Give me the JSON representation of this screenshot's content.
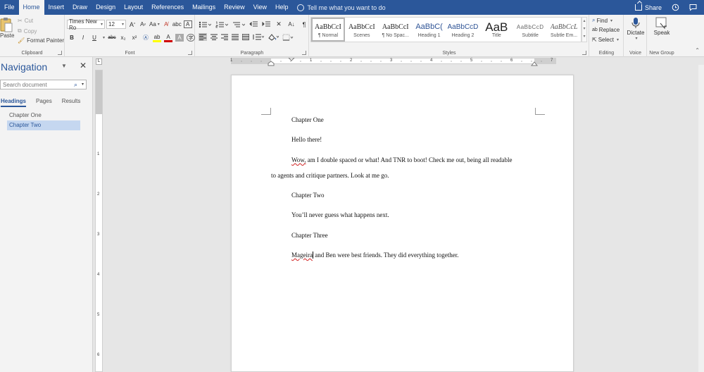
{
  "tabs": [
    {
      "label": "File"
    },
    {
      "label": "Home",
      "active": true
    },
    {
      "label": "Insert"
    },
    {
      "label": "Draw"
    },
    {
      "label": "Design"
    },
    {
      "label": "Layout"
    },
    {
      "label": "References"
    },
    {
      "label": "Mailings"
    },
    {
      "label": "Review"
    },
    {
      "label": "View"
    },
    {
      "label": "Help"
    }
  ],
  "tellme_placeholder": "Tell me what you want to do",
  "share_label": "Share",
  "ribbon": {
    "clipboard": {
      "label": "Clipboard",
      "paste": "Paste",
      "cut": "Cut",
      "copy": "Copy",
      "format_painter": "Format Painter"
    },
    "font": {
      "label": "Font",
      "font_name": "Times New Ro",
      "font_size": "12",
      "bold": "B",
      "italic": "I",
      "underline": "U",
      "strike": "abc",
      "subscript": "x₂",
      "superscript": "x²",
      "grow": "A",
      "shrink": "A",
      "case": "Aa"
    },
    "paragraph": {
      "label": "Paragraph"
    },
    "styles": {
      "label": "Styles",
      "items": [
        {
          "preview": "AaBbCcI",
          "name": "¶ Normal"
        },
        {
          "preview": "AaBbCcI",
          "name": "Scenes"
        },
        {
          "preview": "AaBbCcI",
          "name": "¶ No Spac..."
        },
        {
          "preview": "AaBbC(",
          "name": "Heading 1"
        },
        {
          "preview": "AaBbCcD",
          "name": "Heading 2"
        },
        {
          "preview": "AaB",
          "name": "Title"
        },
        {
          "preview": "AaBbCcD",
          "name": "Subtitle"
        },
        {
          "preview": "AaBbCcL",
          "name": "Subtle Em..."
        }
      ]
    },
    "editing": {
      "label": "Editing",
      "find": "Find",
      "replace": "Replace",
      "select": "Select"
    },
    "voice": {
      "label": "Voice",
      "dictate": "Dictate"
    },
    "new_group": {
      "label": "New Group",
      "speak": "Speak"
    }
  },
  "navigation": {
    "title": "Navigation",
    "search_placeholder": "Search document",
    "tabs": [
      "Headings",
      "Pages",
      "Results"
    ],
    "items": [
      {
        "label": "Chapter One"
      },
      {
        "label": "Chapter Two",
        "selected": true
      }
    ]
  },
  "ruler": {
    "numbers": [
      "1",
      "1",
      "2",
      "3",
      "4",
      "5",
      "6",
      "7"
    ],
    "v_numbers": [
      "1",
      "2",
      "3",
      "4",
      "5",
      "6"
    ]
  },
  "document": {
    "paragraphs": [
      "Chapter One",
      "Hello there!",
      "Wow,",
      " am I double spaced or what! And TNR to boot! Check me out, being all readable",
      "to agents and critique partners. Look at me go.",
      "Chapter Two",
      "You’ll never guess what happens next.",
      "Chapter Three",
      "Mageira",
      " and Ben were best friends. They did everything together."
    ]
  }
}
